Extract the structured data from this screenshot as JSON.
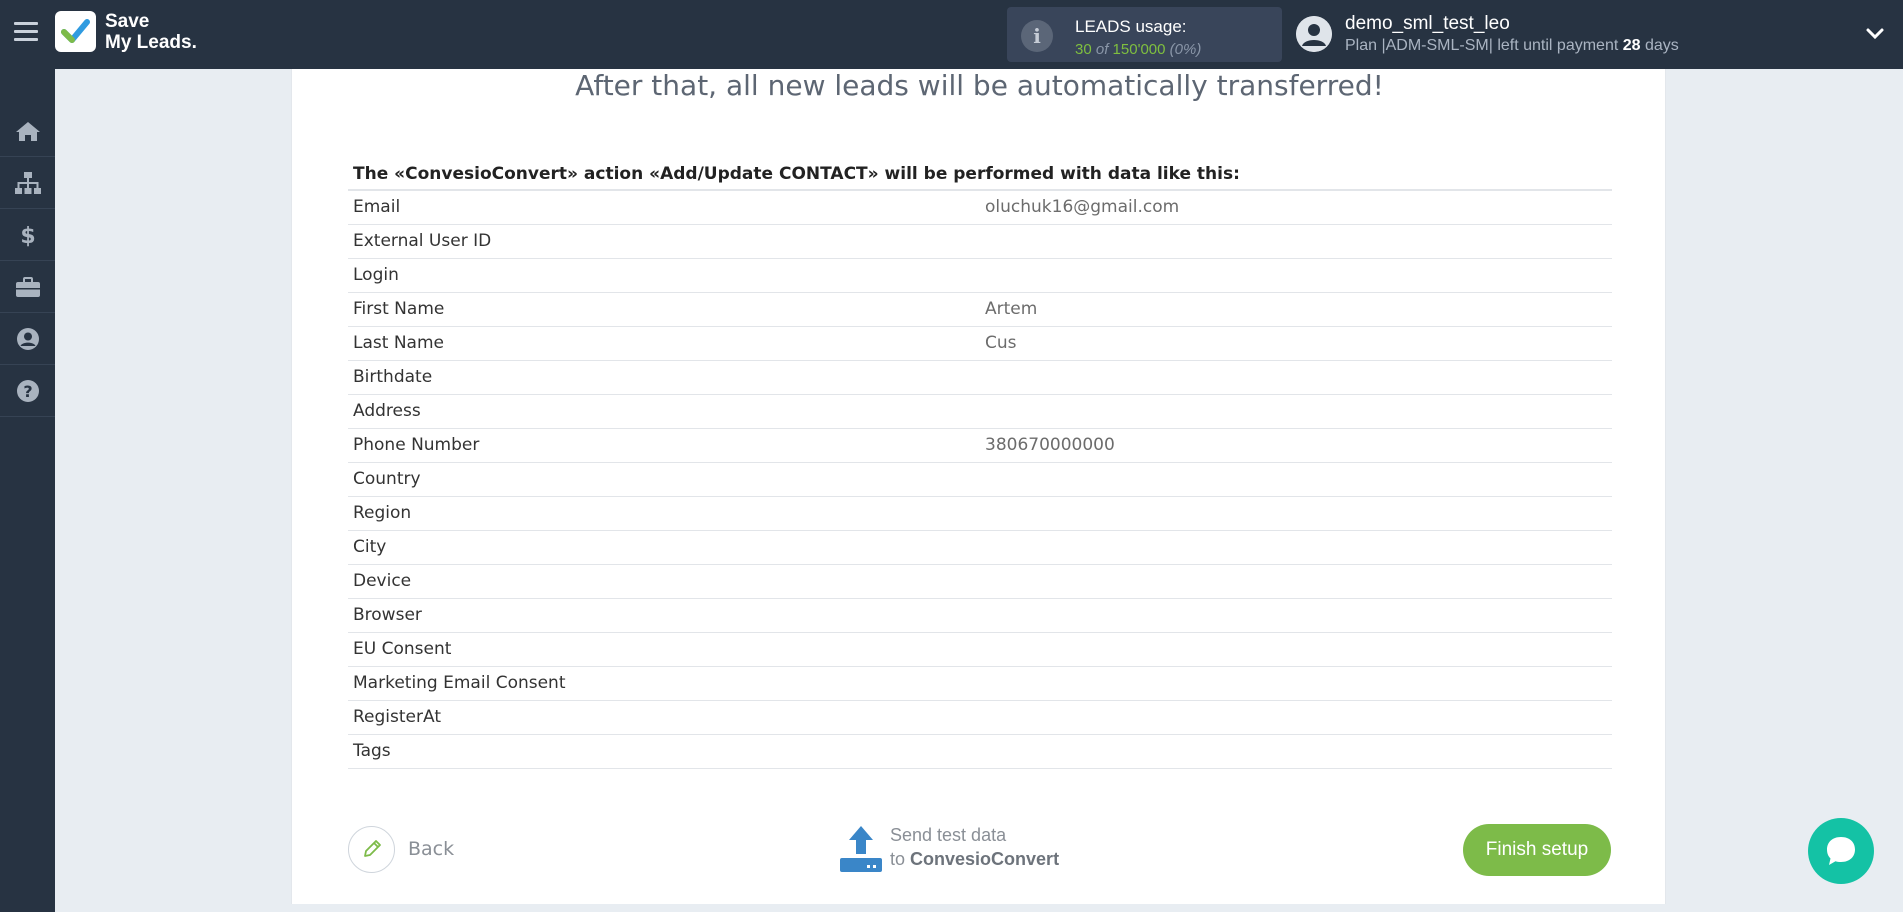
{
  "app": {
    "logo_line1": "Save",
    "logo_line2": "My Leads.",
    "usage_title": "LEADS usage:",
    "usage_used": "30",
    "usage_of": "of",
    "usage_total": "150'000",
    "usage_percent": "(0%)"
  },
  "user": {
    "name": "demo_sml_test_leo",
    "plan_prefix": "Plan |ADM-SML-SM| left until payment",
    "days_count": "28",
    "days_suffix": "days"
  },
  "sidebar": {
    "items": [
      {
        "icon": "home-icon"
      },
      {
        "icon": "sitemap-icon"
      },
      {
        "icon": "dollar-icon"
      },
      {
        "icon": "briefcase-icon"
      },
      {
        "icon": "user-icon"
      },
      {
        "icon": "help-icon"
      }
    ]
  },
  "main": {
    "headline": "After that, all new leads will be automatically transferred!",
    "table_title": "The «ConvesioConvert» action «Add/Update CONTACT» will be performed with data like this:",
    "rows": [
      {
        "field": "Email",
        "value": "oluchuk16@gmail.com"
      },
      {
        "field": "External User ID",
        "value": ""
      },
      {
        "field": "Login",
        "value": ""
      },
      {
        "field": "First Name",
        "value": "Artem"
      },
      {
        "field": "Last Name",
        "value": "Cus"
      },
      {
        "field": "Birthdate",
        "value": ""
      },
      {
        "field": "Address",
        "value": ""
      },
      {
        "field": "Phone Number",
        "value": "380670000000"
      },
      {
        "field": "Country",
        "value": ""
      },
      {
        "field": "Region",
        "value": ""
      },
      {
        "field": "City",
        "value": ""
      },
      {
        "field": "Device",
        "value": ""
      },
      {
        "field": "Browser",
        "value": ""
      },
      {
        "field": "EU Consent",
        "value": ""
      },
      {
        "field": "Marketing Email Consent",
        "value": ""
      },
      {
        "field": "RegisterAt",
        "value": ""
      },
      {
        "field": "Tags",
        "value": ""
      }
    ],
    "back_label": "Back",
    "send_line1": "Send test data",
    "send_to": "to",
    "send_target": "ConvesioConvert",
    "finish_label": "Finish setup"
  },
  "colors": {
    "topbar": "#273342",
    "accent_green": "#7dbb49",
    "chat": "#14c2a5",
    "upload_blue": "#3a86c8"
  }
}
